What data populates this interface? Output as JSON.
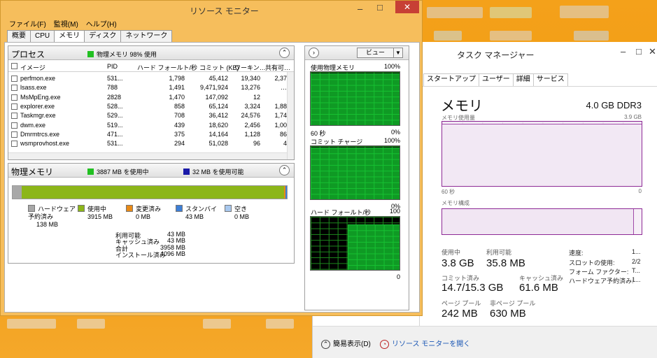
{
  "resmon": {
    "title": "リソース モニター",
    "menu": [
      "ファイル(F)",
      "監視(M)",
      "ヘルプ(H)"
    ],
    "tabs": [
      "概要",
      "CPU",
      "メモリ",
      "ディスク",
      "ネットワーク"
    ],
    "active_tab": "メモリ",
    "process_panel": {
      "title": "プロセス",
      "status": "物理メモリ 98% 使用",
      "status_color": "#22c022",
      "columns": [
        "イメージ",
        "PID",
        "ハード フォールト/秒",
        "コミット (KB)",
        "ワーキン…",
        "共有可…"
      ],
      "rows": [
        [
          "perfmon.exe",
          "531...",
          "1,798",
          "45,412",
          "19,340",
          "2,37"
        ],
        [
          "lsass.exe",
          "788",
          "1,491",
          "9,471,924",
          "13,276",
          "…"
        ],
        [
          "MsMpEng.exe",
          "2828",
          "1,470",
          "147,092",
          "12",
          ""
        ],
        [
          "explorer.exe",
          "528...",
          "858",
          "65,124",
          "3,324",
          "1,88"
        ],
        [
          "Taskmgr.exe",
          "529...",
          "708",
          "36,412",
          "24,576",
          "1,74"
        ],
        [
          "dwm.exe",
          "519...",
          "439",
          "18,620",
          "2,456",
          "1,00"
        ],
        [
          "Dmrmtrcs.exe",
          "471...",
          "375",
          "14,164",
          "1,128",
          "86"
        ],
        [
          "wsmprovhost.exe",
          "531...",
          "294",
          "51,028",
          "96",
          "4"
        ]
      ]
    },
    "physical_panel": {
      "title": "物理メモリ",
      "in_use_text": "3887 MB を使用中",
      "available_text": "32 MB を使用可能",
      "in_use_color": "#22c022",
      "available_color": "#1a1aa8",
      "legend": [
        {
          "label": "ハードウェア予約済み",
          "value": "138 MB",
          "color": "#a8a8a8"
        },
        {
          "label": "使用中",
          "value": "3915 MB",
          "color": "#8cb619"
        },
        {
          "label": "変更済み",
          "value": "0 MB",
          "color": "#e88a17"
        },
        {
          "label": "スタンバイ",
          "value": "43 MB",
          "color": "#3d7fd6"
        },
        {
          "label": "空き",
          "value": "0 MB",
          "color": "#a8c8ee"
        }
      ],
      "stats": [
        {
          "label": "利用可能",
          "value": "43 MB"
        },
        {
          "label": "キャッシュ済み",
          "value": "43 MB"
        },
        {
          "label": "合計",
          "value": "3958 MB"
        },
        {
          "label": "インストール済み",
          "value": "4096 MB"
        }
      ]
    },
    "graphs": {
      "view_label": "ビュー",
      "items": [
        {
          "title": "使用物理メモリ",
          "top": "100%",
          "bottom_left": "60 秒",
          "bottom_right": "0%",
          "fill_fraction": 0.98
        },
        {
          "title": "コミット チャージ",
          "top": "100%",
          "bottom_left": "",
          "bottom_right": "0%",
          "fill_fraction": 0.97
        },
        {
          "title": "ハード フォールト/秒",
          "top": "100",
          "bottom_left": "",
          "bottom_right": "0",
          "fill_fraction": 0.85
        }
      ]
    }
  },
  "taskmgr": {
    "title": "タスク マネージャー",
    "tabs": [
      "スタートアップ",
      "ユーザー",
      "詳細",
      "サービス"
    ],
    "heading": "メモリ",
    "spec": "4.0 GB DDR3",
    "usage_label": "メモリ使用量",
    "usage_max": "3.9 GB",
    "time_left": "60 秒",
    "time_right": "0",
    "composition_label": "メモリ構成",
    "stats": [
      {
        "label": "使用中",
        "value": "3.8 GB"
      },
      {
        "label": "利用可能",
        "value": "35.8 MB"
      },
      {
        "label": "コミット済み",
        "value": "14.7/15.3 GB"
      },
      {
        "label": "キャッシュ済み",
        "value": "61.6 MB"
      },
      {
        "label": "ページ プール",
        "value": "242 MB"
      },
      {
        "label": "非ページ プール",
        "value": "630 MB"
      }
    ],
    "details": [
      {
        "key": "速度:",
        "value": "1..."
      },
      {
        "key": "スロットの使用:",
        "value": "2/2"
      },
      {
        "key": "フォーム ファクター:",
        "value": "T..."
      },
      {
        "key": "ハードウェア予約済み:",
        "value": "1..."
      }
    ],
    "footer": {
      "summary": "簡易表示(D)",
      "open_resmon": "リソース モニターを開く"
    }
  }
}
